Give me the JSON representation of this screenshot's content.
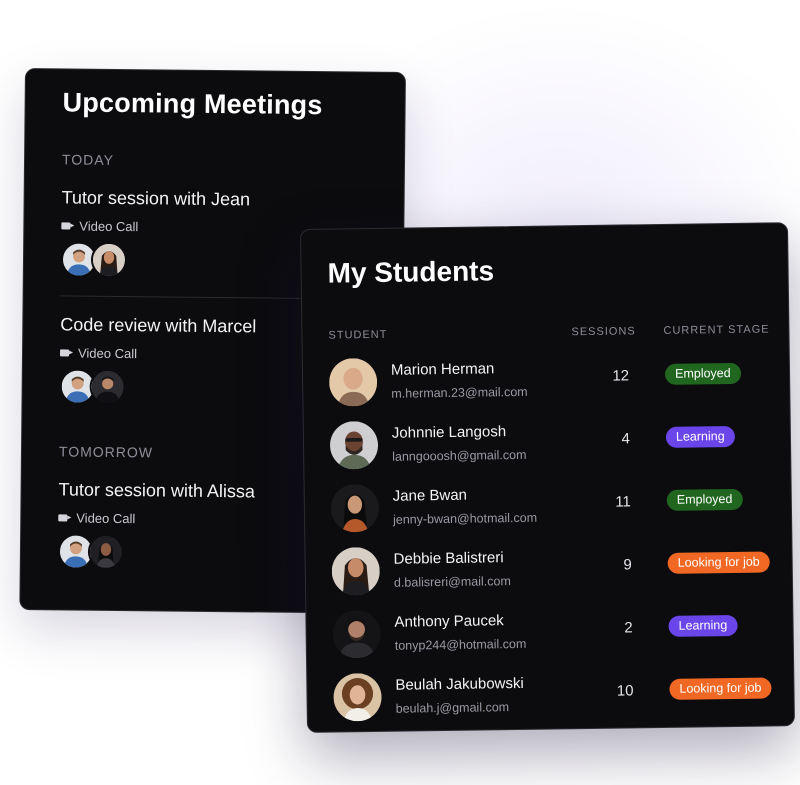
{
  "meetings": {
    "title": "Upcoming Meetings",
    "sections": [
      {
        "label": "TODAY",
        "items": [
          {
            "title": "Tutor session with Jean",
            "call_type": "Video Call",
            "participants": [
              "man-blue-shirt",
              "woman-long-hair"
            ]
          },
          {
            "title": "Code review with Marcel",
            "call_type": "Video Call",
            "participants": [
              "man-blue-shirt",
              "man-dark-jacket"
            ]
          }
        ]
      },
      {
        "label": "TOMORROW",
        "items": [
          {
            "title": "Tutor session with Alissa",
            "call_type": "Video Call",
            "participants": [
              "man-blue-shirt",
              "woman-dark-hair"
            ]
          }
        ]
      }
    ]
  },
  "students": {
    "title": "My Students",
    "columns": {
      "student": "STUDENT",
      "sessions": "SESSIONS",
      "stage": "CURRENT STAGE"
    },
    "rows": [
      {
        "name": "Marion Herman",
        "email": "m.herman.23@mail.com",
        "sessions": "12",
        "stage": "Employed",
        "stage_color": "#20661f",
        "avatar": "bald-woman"
      },
      {
        "name": "Johnnie Langosh",
        "email": "lanngooosh@gmail.com",
        "sessions": "4",
        "stage": "Learning",
        "stage_color": "#6a45ea",
        "avatar": "man-beard-glasses"
      },
      {
        "name": "Jane Bwan",
        "email": "jenny-bwan@hotmail.com",
        "sessions": "11",
        "stage": "Employed",
        "stage_color": "#20661f",
        "avatar": "woman-dark-background"
      },
      {
        "name": "Debbie Balistreri",
        "email": "d.balisreri@mail.com",
        "sessions": "9",
        "stage": "Looking for job",
        "stage_color": "#f06824",
        "avatar": "woman-long-hair"
      },
      {
        "name": "Anthony Paucek",
        "email": "tonyp244@hotmail.com",
        "sessions": "2",
        "stage": "Learning",
        "stage_color": "#6a45ea",
        "avatar": "man-dark-background"
      },
      {
        "name": "Beulah Jakubowski",
        "email": "beulah.j@gmail.com",
        "sessions": "10",
        "stage": "Looking for job",
        "stage_color": "#f06824",
        "avatar": "woman-curly-hair"
      }
    ]
  },
  "colors": {
    "card_background": "#0c0c0f",
    "employed": "#20661f",
    "learning": "#6a45ea",
    "looking_for_job": "#f06824"
  }
}
